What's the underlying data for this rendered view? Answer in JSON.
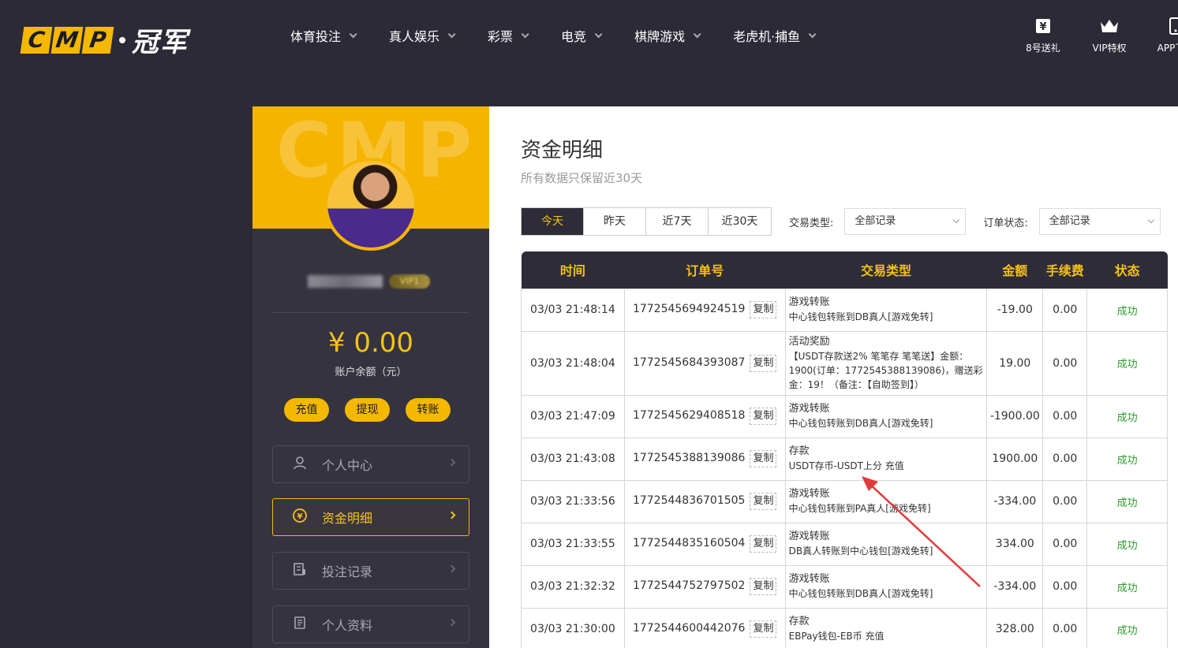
{
  "header": {
    "logo_letters": [
      "C",
      "M",
      "P"
    ],
    "logo_text": "冠军",
    "nav": [
      {
        "label": "体育投注"
      },
      {
        "label": "真人娱乐"
      },
      {
        "label": "彩票"
      },
      {
        "label": "电竞"
      },
      {
        "label": "棋牌游戏"
      },
      {
        "label": "老虎机·捕鱼"
      }
    ],
    "right_links": [
      {
        "label": "8号送礼",
        "icon": "yen-gift-icon"
      },
      {
        "label": "VIP特权",
        "icon": "crown-icon"
      },
      {
        "label": "APP下载",
        "icon": "phone-icon"
      }
    ]
  },
  "sidebar": {
    "banner_watermark": "CMP",
    "vip_text": "VIP1",
    "balance": "¥ 0.00",
    "balance_label": "账户余额（元）",
    "actions": [
      "充值",
      "提现",
      "转账"
    ],
    "menu": [
      {
        "label": "个人中心",
        "icon": "user-icon",
        "active": false
      },
      {
        "label": "资金明细",
        "icon": "yen-circle-icon",
        "active": true
      },
      {
        "label": "投注记录",
        "icon": "bet-record-icon",
        "active": false
      },
      {
        "label": "个人资料",
        "icon": "profile-doc-icon",
        "active": false
      }
    ]
  },
  "main": {
    "title": "资金明细",
    "subtitle": "所有数据只保留近30天",
    "date_tabs": [
      "今天",
      "昨天",
      "近7天",
      "近30天"
    ],
    "active_date_tab": "今天",
    "type_filter_label": "交易类型:",
    "type_filter_value": "全部记录",
    "status_filter_label": "订单状态:",
    "status_filter_value": "全部记录",
    "table": {
      "columns": [
        "时间",
        "订单号",
        "交易类型",
        "金额",
        "手续费",
        "状态"
      ],
      "copy_label": "复制",
      "rows": [
        {
          "time": "03/03 21:48:14",
          "order": "1772545694924519",
          "type": "游戏转账",
          "desc": "中心钱包转账到DB真人[游戏免转]",
          "amount": "-19.00",
          "fee": "0.00",
          "status": "成功"
        },
        {
          "time": "03/03 21:48:04",
          "order": "1772545684393087",
          "type": "活动奖励",
          "desc": "【USDT存款送2% 笔笔存 笔笔送】金额：1900(订单：1772545388139086)，赠送彩金：19！（备注：【自助签到】）",
          "amount": "19.00",
          "fee": "0.00",
          "status": "成功"
        },
        {
          "time": "03/03 21:47:09",
          "order": "1772545629408518",
          "type": "游戏转账",
          "desc": "中心钱包转账到DB真人[游戏免转]",
          "amount": "-1900.00",
          "fee": "0.00",
          "status": "成功"
        },
        {
          "time": "03/03 21:43:08",
          "order": "1772545388139086",
          "type": "存款",
          "desc": "USDT存币-USDT上分 充值",
          "amount": "1900.00",
          "fee": "0.00",
          "status": "成功"
        },
        {
          "time": "03/03 21:33:56",
          "order": "1772544836701505",
          "type": "游戏转账",
          "desc": "中心钱包转账到PA真人[游戏免转]",
          "amount": "-334.00",
          "fee": "0.00",
          "status": "成功"
        },
        {
          "time": "03/03 21:33:55",
          "order": "1772544835160504",
          "type": "游戏转账",
          "desc": "DB真人转账到中心钱包[游戏免转]",
          "amount": "334.00",
          "fee": "0.00",
          "status": "成功"
        },
        {
          "time": "03/03 21:32:32",
          "order": "1772544752797502",
          "type": "游戏转账",
          "desc": "中心钱包转账到DB真人[游戏免转]",
          "amount": "-334.00",
          "fee": "0.00",
          "status": "成功"
        },
        {
          "time": "03/03 21:30:00",
          "order": "1772544600442076",
          "type": "存款",
          "desc": "EBPay钱包-EB币 充值",
          "amount": "328.00",
          "fee": "0.00",
          "status": "成功"
        }
      ]
    }
  },
  "colors": {
    "accent": "#f5b800",
    "bg_dark": "#2b2a36",
    "success": "#2a9d2a",
    "annotation_arrow": "#e23b3b"
  }
}
